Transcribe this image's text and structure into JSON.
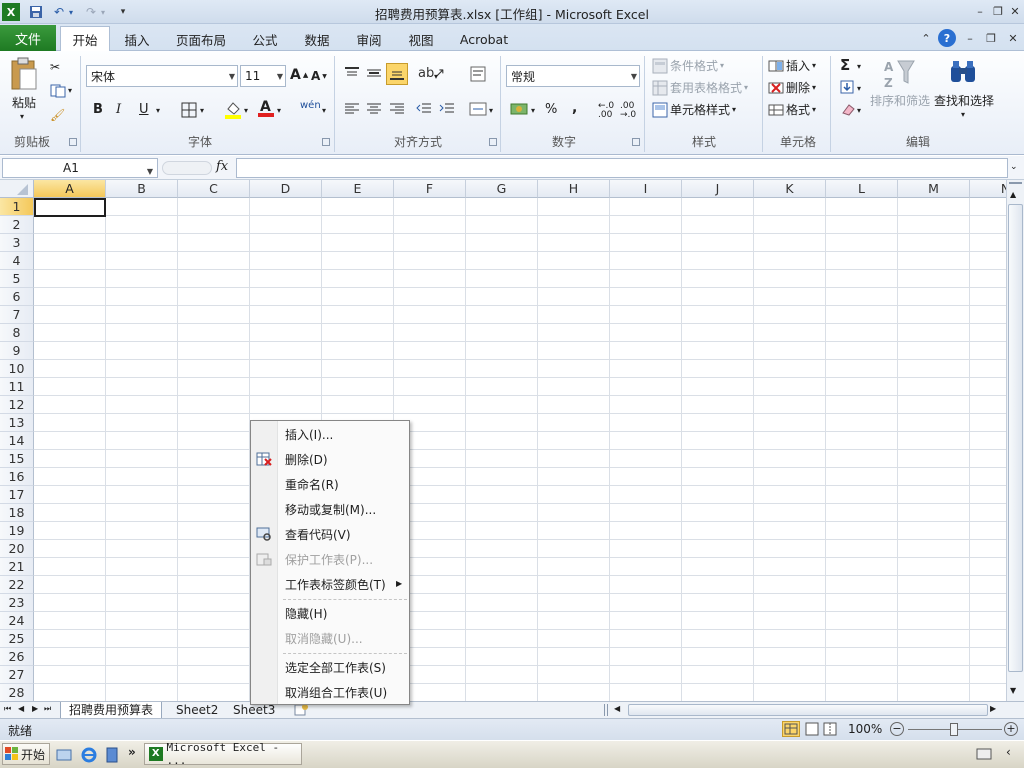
{
  "window": {
    "title": "招聘费用预算表.xlsx  [工作组] - Microsoft Excel"
  },
  "tabs": {
    "file": "文件",
    "items": [
      "开始",
      "插入",
      "页面布局",
      "公式",
      "数据",
      "审阅",
      "视图",
      "Acrobat"
    ],
    "active": "开始"
  },
  "ribbon": {
    "clipboard": {
      "paste": "粘贴",
      "label": "剪贴板"
    },
    "font": {
      "name": "宋体",
      "size": "11",
      "label": "字体",
      "bold": "B",
      "italic": "I",
      "underline": "U"
    },
    "alignment": {
      "label": "对齐方式"
    },
    "number": {
      "format": "常规",
      "label": "数字",
      "percent": "%",
      "comma": ","
    },
    "styles": {
      "conditional": "条件格式",
      "table": "套用表格格式",
      "cell": "单元格样式",
      "label": "样式"
    },
    "cells": {
      "insert": "插入",
      "delete": "删除",
      "format": "格式",
      "label": "单元格"
    },
    "editing": {
      "sort": "排序和筛选",
      "find": "查找和选择",
      "label": "编辑"
    }
  },
  "formula_bar": {
    "name_box": "A1",
    "fx": "fx",
    "value": ""
  },
  "grid": {
    "columns": [
      "A",
      "B",
      "C",
      "D",
      "E",
      "F",
      "G",
      "H",
      "I",
      "J",
      "K",
      "L",
      "M",
      "N"
    ],
    "rows": [
      "1",
      "2",
      "3",
      "4",
      "5",
      "6",
      "7",
      "8",
      "9",
      "10",
      "11",
      "12",
      "13",
      "14",
      "15",
      "16",
      "17",
      "18",
      "19",
      "20",
      "21",
      "22",
      "23",
      "24",
      "25",
      "26",
      "27",
      "28"
    ],
    "selected_cell": "A1"
  },
  "sheets": [
    "招聘费用预算表",
    "Sheet2",
    "Sheet3"
  ],
  "status": {
    "ready": "就绪",
    "zoom": "100%"
  },
  "context_menu": {
    "items": [
      {
        "label": "插入(I)...",
        "disabled": false
      },
      {
        "label": "删除(D)",
        "disabled": false
      },
      {
        "label": "重命名(R)",
        "disabled": false
      },
      {
        "label": "移动或复制(M)...",
        "disabled": false
      },
      {
        "label": "查看代码(V)",
        "disabled": false
      },
      {
        "label": "保护工作表(P)...",
        "disabled": true
      },
      {
        "label": "工作表标签颜色(T)",
        "disabled": false
      },
      {
        "label": "隐藏(H)",
        "disabled": false
      },
      {
        "label": "取消隐藏(U)...",
        "disabled": true
      },
      {
        "label": "选定全部工作表(S)",
        "disabled": false
      },
      {
        "label": "取消组合工作表(U)",
        "disabled": false
      }
    ]
  },
  "taskbar": {
    "start": "开始",
    "task": "Microsoft Excel - ..."
  },
  "colors": {
    "file_tab": "#1e7a23",
    "selection": "#f4c85a"
  }
}
